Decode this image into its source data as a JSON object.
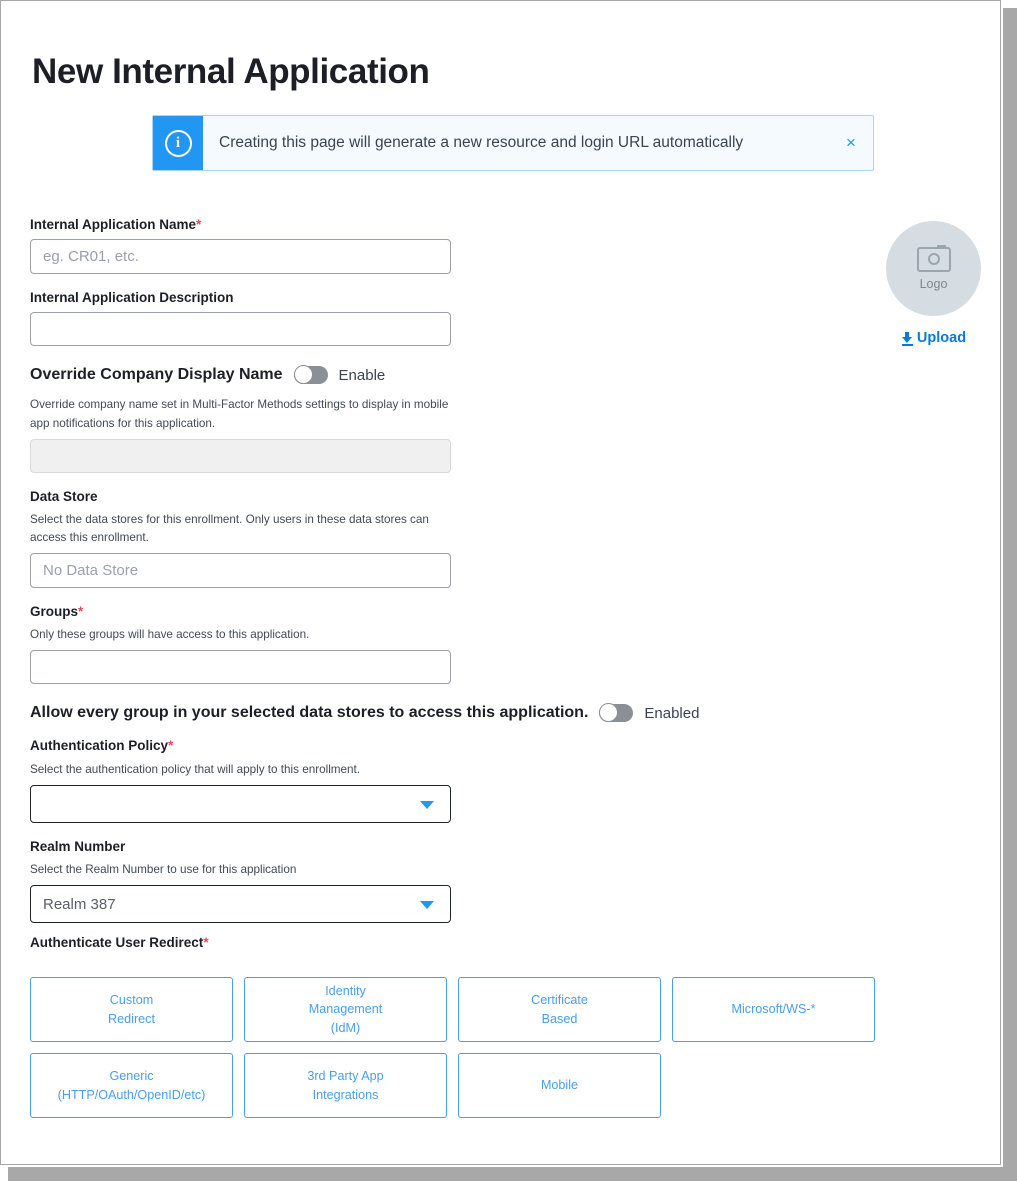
{
  "page": {
    "title": "New Internal Application"
  },
  "banner": {
    "icon": "info-circle-icon",
    "glyph": "i",
    "message": "Creating this page will generate a new resource and login URL automatically",
    "close_label": "×",
    "accent_color": "#2196f3",
    "background_color": "#f4faff"
  },
  "form": {
    "app_name": {
      "label": "Internal Application Name",
      "required": true,
      "required_mark": "*",
      "placeholder": "eg. CR01, etc.",
      "value": ""
    },
    "app_description": {
      "label": "Internal Application Description",
      "required": false,
      "placeholder": "",
      "value": ""
    },
    "override_display_name": {
      "label": "Override Company Display Name",
      "toggle_state_label": "Enable",
      "toggle_on": false,
      "help": "Override company name set in Multi-Factor Methods settings to display in mobile app notifications for this application.",
      "input_value": "",
      "input_disabled": true
    },
    "data_store": {
      "label": "Data Store",
      "help": "Select the data stores for this enrollment. Only users in these data stores can access this enrollment.",
      "placeholder": "No Data Store",
      "value": ""
    },
    "groups": {
      "label": "Groups",
      "required": true,
      "required_mark": "*",
      "help": "Only these groups will have access to this application.",
      "value": ""
    },
    "allow_every_group": {
      "label": "Allow every group in your selected data stores to access this application.",
      "toggle_state_label": "Enabled",
      "toggle_on": false
    },
    "authentication_policy": {
      "label": "Authentication Policy",
      "required": true,
      "required_mark": "*",
      "help": "Select the authentication policy that will apply to this enrollment.",
      "selected": ""
    },
    "realm_number": {
      "label": "Realm Number",
      "help": "Select the Realm Number to use for this application",
      "selected": "Realm 387"
    },
    "authenticate_user_redirect": {
      "label": "Authenticate User Redirect",
      "required": true,
      "required_mark": "*",
      "options": [
        "Custom\nRedirect",
        "Identity\nManagement\n(IdM)",
        "Certificate\nBased",
        "Microsoft/WS-*",
        "Generic\n(HTTP/OAuth/OpenID/etc)",
        "3rd Party App\nIntegrations",
        "Mobile"
      ]
    }
  },
  "logo": {
    "icon": "camera-icon",
    "caption": "Logo",
    "upload_label": "Upload",
    "upload_icon": "download-arrow-icon",
    "link_color": "#0b7ad6"
  }
}
